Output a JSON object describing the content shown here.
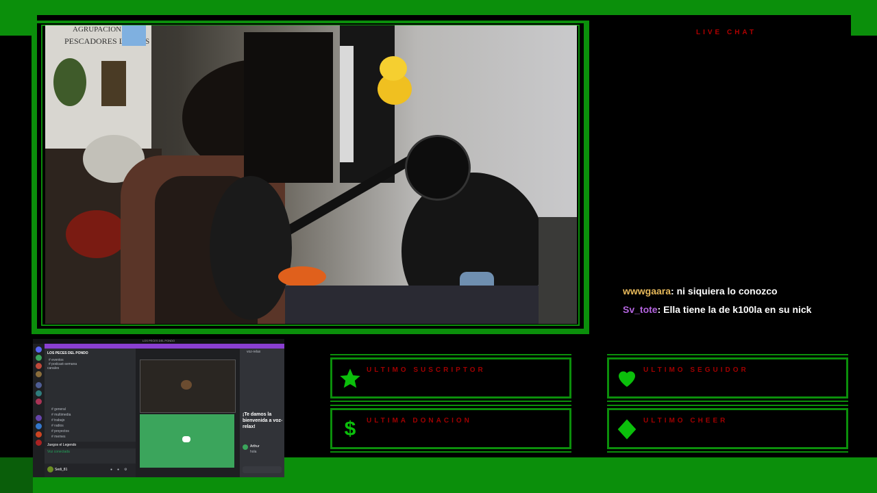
{
  "chat": {
    "title": "LIVE CHAT",
    "messages": [
      {
        "user": "wwwgaara",
        "text": ": ni siquiera lo conozco",
        "user_color": "#e6b85a"
      },
      {
        "user": "Sv_tote",
        "text": ": Ella tiene la de k100la en su nick",
        "user_color": "#b565e0"
      }
    ]
  },
  "alerts": {
    "subscriber": {
      "label": "ULTIMO SUSCRIPTOR",
      "icon": "star-icon"
    },
    "follower": {
      "label": "ULTIMO SEGUIDOR",
      "icon": "heart-icon"
    },
    "donation": {
      "label": "ULTIMA DONACION",
      "icon": "dollar-icon"
    },
    "cheer": {
      "label": "ULTIMO CHEER",
      "icon": "diamond-icon"
    }
  },
  "webcam": {
    "poster_text_1": "AGRUPACION",
    "poster_text_2": "PESCADORES LEALES"
  },
  "discord": {
    "window_title": "LOS PECES DEL PONDO",
    "server_name": "LOS PECES DEL PONDO",
    "welcome_title": "¡Te damos la bienvenida a voz-relax!",
    "voice_label": "voz-relax",
    "user_name": "Sedi_81",
    "connected_label": "Voz conectada",
    "channels": [
      "# eventos",
      "# podcast-semana",
      "# general",
      "# multimedia",
      "# trabajo",
      "# radios",
      "# proyectos",
      "# memes"
    ],
    "section_label": "canales",
    "play_label": "Juegos el Legendo",
    "msg_user": "Arthur",
    "msg_text": "hola"
  },
  "colors": {
    "frame": "#0b8f0b",
    "label": "#a00000",
    "accent": "#0bbf0b"
  }
}
